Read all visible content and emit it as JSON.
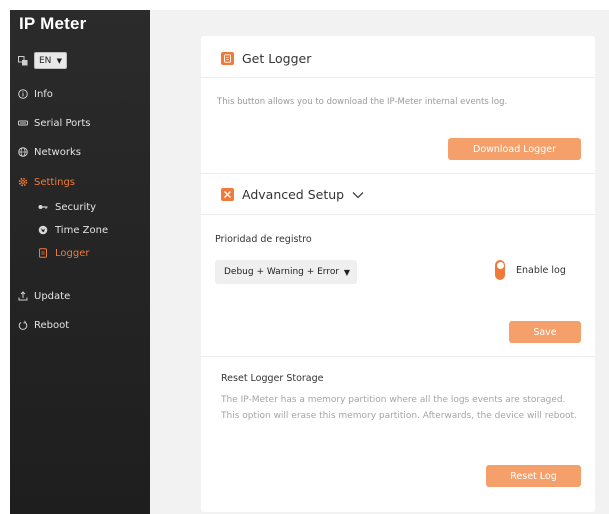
{
  "app": {
    "title": "IP Meter"
  },
  "language": {
    "selected": "EN"
  },
  "sidebar": {
    "items": [
      {
        "label": "Info",
        "icon": "info-icon"
      },
      {
        "label": "Serial Ports",
        "icon": "serial-port-icon"
      },
      {
        "label": "Networks",
        "icon": "globe-icon"
      },
      {
        "label": "Settings",
        "icon": "gear-icon"
      },
      {
        "label": "Update",
        "icon": "upload-icon"
      },
      {
        "label": "Reboot",
        "icon": "power-icon"
      }
    ],
    "settings_sub": [
      {
        "label": "Security",
        "icon": "key-icon"
      },
      {
        "label": "Time Zone",
        "icon": "globe-clock-icon"
      },
      {
        "label": "Logger",
        "icon": "document-icon"
      }
    ],
    "active": "Logger",
    "accent_color": "#f07a3a"
  },
  "get_logger": {
    "title": "Get Logger",
    "description": "This button allows you to download the IP-Meter internal events log.",
    "button_label": "Download Logger"
  },
  "advanced": {
    "title": "Advanced Setup",
    "priority_label": "Prioridad de registro",
    "priority_value": "Debug + Warning + Error",
    "enable_log_label": "Enable log",
    "enable_log_on": true,
    "save_label": "Save"
  },
  "reset": {
    "title": "Reset Logger Storage",
    "description": "The IP-Meter has a memory partition where all the logs events are storaged. This option will erase this memory partition. Afterwards, the device will reboot.",
    "button_label": "Reset Log"
  }
}
